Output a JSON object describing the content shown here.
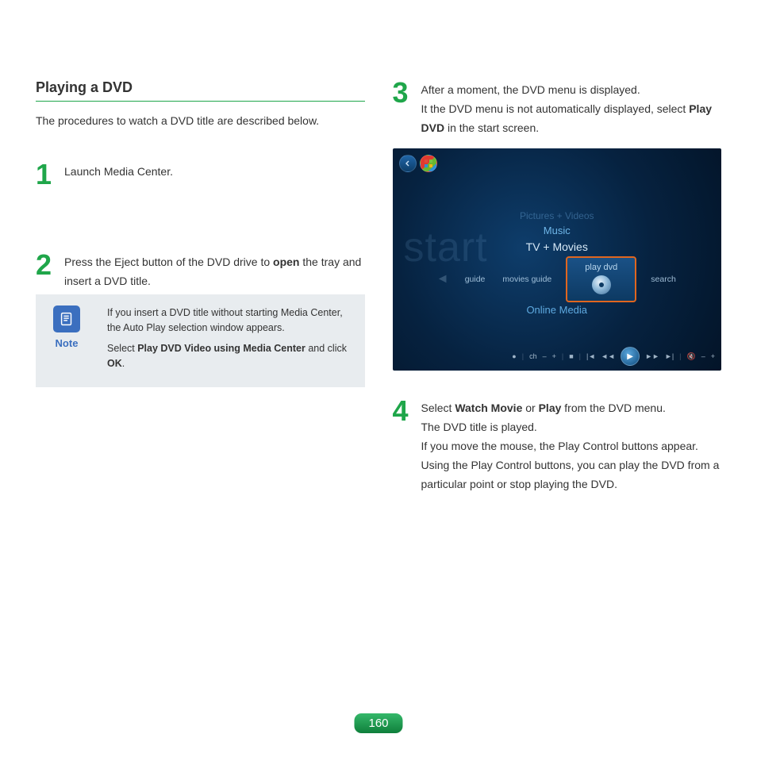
{
  "title": "Playing a DVD",
  "intro": "The procedures to watch a DVD title are described below.",
  "steps": {
    "s1": {
      "num": "1",
      "text": "Launch Media Center."
    },
    "s2": {
      "num": "2",
      "pre": "Press the Eject button of the DVD drive to ",
      "bold1": "open",
      "post": " the tray and insert a DVD title."
    },
    "s3": {
      "num": "3",
      "line1": "After a moment, the DVD menu is displayed.",
      "line2a": "It the DVD menu is not automatically displayed, select ",
      "line2b": "Play DVD",
      "line2c": " in the start screen."
    },
    "s4": {
      "num": "4",
      "l1a": "Select ",
      "l1b": "Watch Movie",
      "l1c": " or ",
      "l1d": "Play",
      "l1e": " from the DVD menu.",
      "l2": "The DVD title is played.",
      "l3": "If you move the mouse, the Play Control buttons appear. Using the Play Control buttons, you can play the DVD from a particular point or stop playing the DVD."
    }
  },
  "note": {
    "label": "Note",
    "p1": "If you insert a DVD title without starting Media Center, the Auto Play selection window appears.",
    "p2a": "Select ",
    "p2b": "Play DVD Video using Media Center",
    "p2c": " and click ",
    "p2d": "OK",
    "p2e": "."
  },
  "screenshot": {
    "start_text": "start",
    "rows": {
      "pictures": "Pictures + Videos",
      "music": "Music",
      "tv": "TV + Movies",
      "online": "Online Media"
    },
    "tiles": {
      "guide": "guide",
      "movies_guide": "movies guide",
      "play_dvd": "play dvd",
      "search": "search"
    },
    "controls": {
      "ch": "ch",
      "minus": "–",
      "plus": "+",
      "rec": "●"
    }
  },
  "page_number": "160"
}
